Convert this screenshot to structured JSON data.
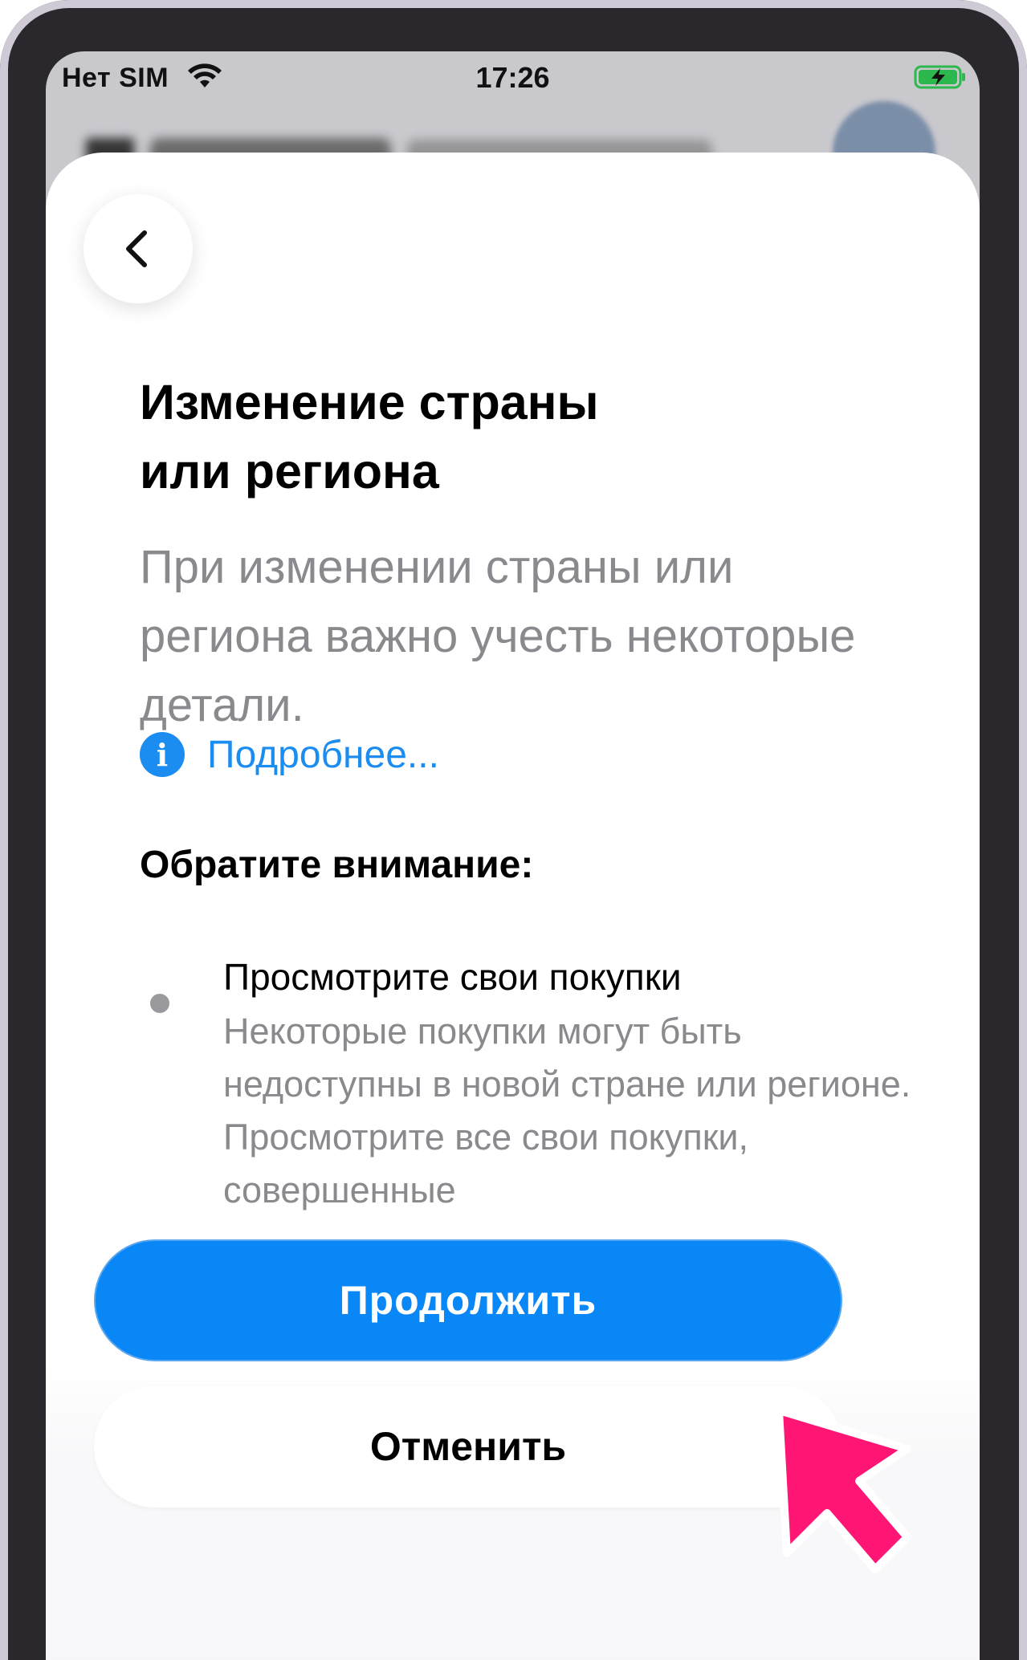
{
  "status_bar": {
    "carrier": "Нет SIM",
    "time": "17:26"
  },
  "sheet": {
    "title_line1": "Изменение страны",
    "title_line2": "или региона",
    "subtitle": "При изменении страны или региона важно учесть некоторые детали.",
    "info_link": "Подробнее...",
    "section_heading": "Обратите внимание:",
    "items": [
      {
        "title": "Просмотрите свои покупки",
        "description": "Некоторые покупки могут быть недоступны в новой стране или регионе. Просмотрите все свои покупки, совершенные"
      }
    ]
  },
  "buttons": {
    "continue": "Продолжить",
    "cancel": "Отменить"
  },
  "colors": {
    "accent": "#0a87f7",
    "pointer": "#ff1574"
  }
}
